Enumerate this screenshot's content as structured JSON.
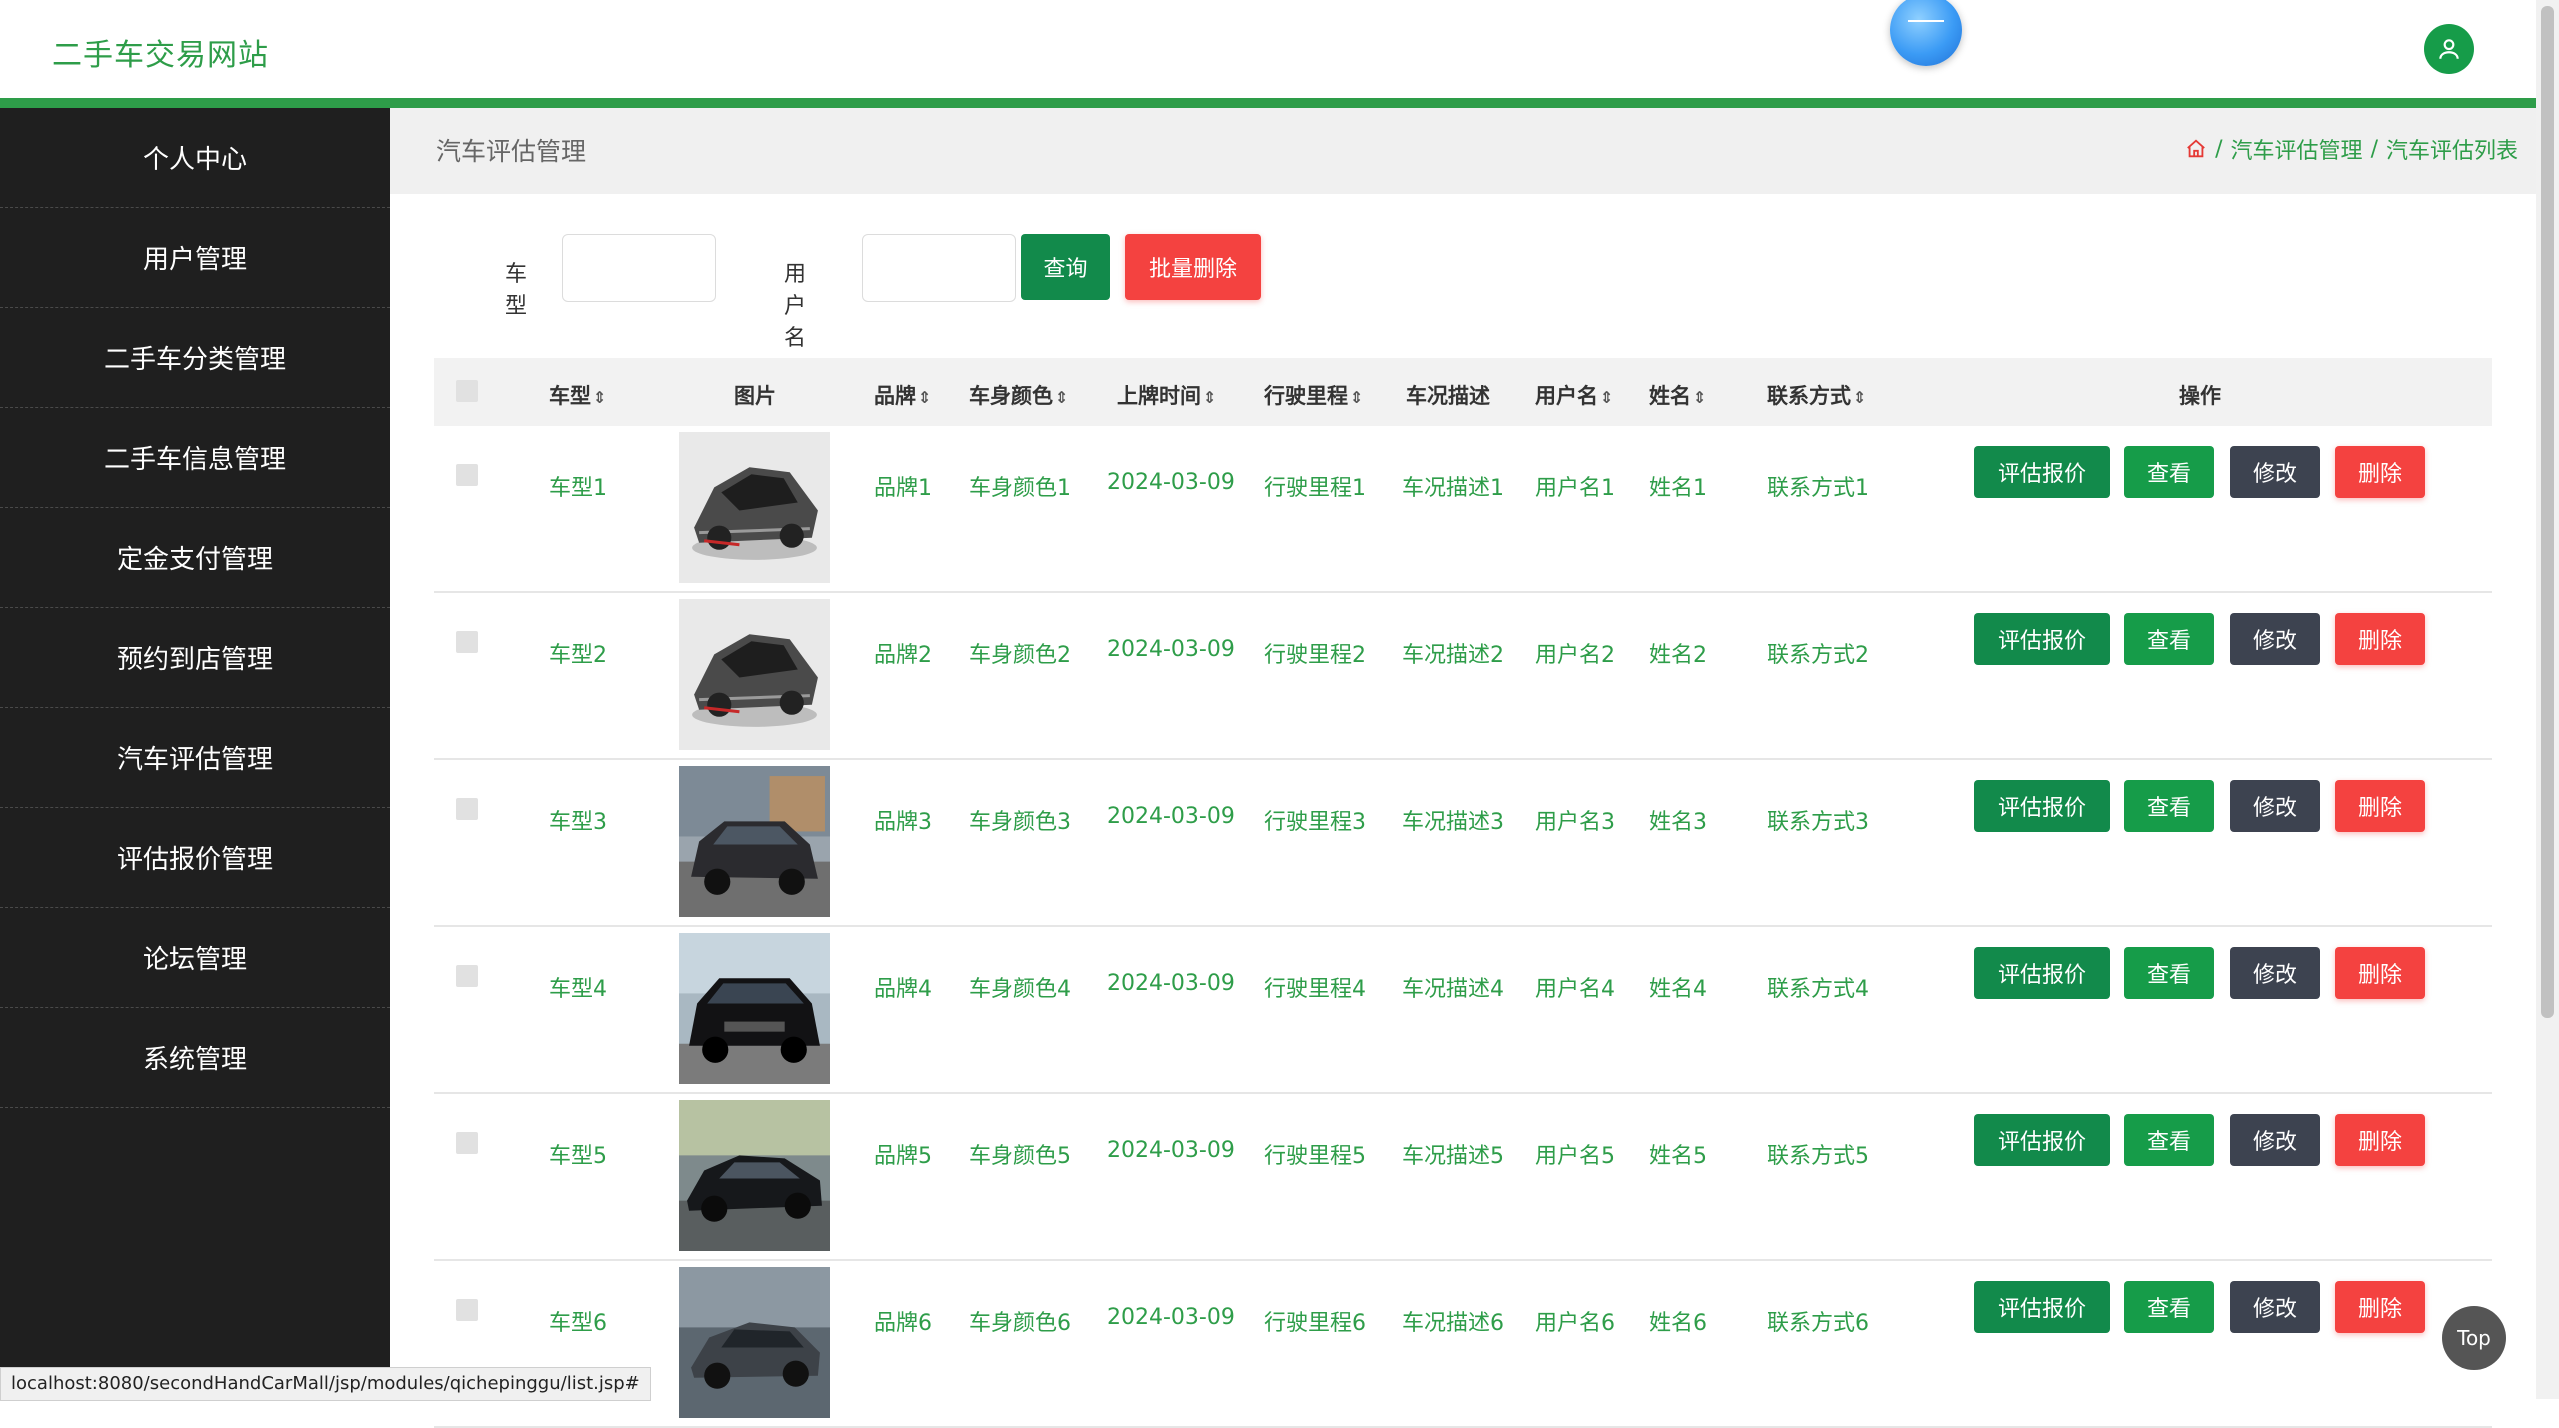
{
  "header": {
    "site_title": "二手车交易网站"
  },
  "sidebar": {
    "items": [
      {
        "label": "个人中心"
      },
      {
        "label": "用户管理"
      },
      {
        "label": "二手车分类管理"
      },
      {
        "label": "二手车信息管理"
      },
      {
        "label": "定金支付管理"
      },
      {
        "label": "预约到店管理"
      },
      {
        "label": "汽车评估管理"
      },
      {
        "label": "评估报价管理"
      },
      {
        "label": "论坛管理"
      },
      {
        "label": "系统管理"
      }
    ]
  },
  "page": {
    "title": "汽车评估管理",
    "breadcrumb": [
      "汽车评估管理",
      "汽车评估列表"
    ],
    "breadcrumb_sep": "/"
  },
  "search": {
    "car_model_label": "车型",
    "car_model_value": "",
    "username_label": "用户名",
    "username_value": "",
    "query_label": "查询",
    "batch_delete_label": "批量删除"
  },
  "table": {
    "headers": {
      "model": "车型",
      "image": "图片",
      "brand": "品牌",
      "color": "车身颜色",
      "plate_date": "上牌时间",
      "mileage": "行驶里程",
      "condition": "车况描述",
      "username": "用户名",
      "name": "姓名",
      "contact": "联系方式",
      "actions": "操作"
    },
    "sort_icon": "sort-caret",
    "action_labels": {
      "appraise": "评估报价",
      "view": "查看",
      "edit": "修改",
      "delete": "删除"
    },
    "rows": [
      {
        "model": "车型1",
        "brand": "品牌1",
        "color": "车身颜色1",
        "plate_date": "2024-03-09",
        "mileage": "行驶里程1",
        "condition": "车况描述1",
        "username": "用户名1",
        "name": "姓名1",
        "contact": "联系方式1",
        "car_style": "supercar-silver"
      },
      {
        "model": "车型2",
        "brand": "品牌2",
        "color": "车身颜色2",
        "plate_date": "2024-03-09",
        "mileage": "行驶里程2",
        "condition": "车况描述2",
        "username": "用户名2",
        "name": "姓名2",
        "contact": "联系方式2",
        "car_style": "supercar-silver"
      },
      {
        "model": "车型3",
        "brand": "品牌3",
        "color": "车身颜色3",
        "plate_date": "2024-03-09",
        "mileage": "行驶里程3",
        "condition": "车况描述3",
        "username": "用户名3",
        "name": "姓名3",
        "contact": "联系方式3",
        "car_style": "suv-dark"
      },
      {
        "model": "车型4",
        "brand": "品牌4",
        "color": "车身颜色4",
        "plate_date": "2024-03-09",
        "mileage": "行驶里程4",
        "condition": "车况描述4",
        "username": "用户名4",
        "name": "姓名4",
        "contact": "联系方式4",
        "car_style": "suv-black"
      },
      {
        "model": "车型5",
        "brand": "品牌5",
        "color": "车身颜色5",
        "plate_date": "2024-03-09",
        "mileage": "行驶里程5",
        "condition": "车况描述5",
        "username": "用户名5",
        "name": "姓名5",
        "contact": "联系方式5",
        "car_style": "sedan-black"
      },
      {
        "model": "车型6",
        "brand": "品牌6",
        "color": "车身颜色6",
        "plate_date": "2024-03-09",
        "mileage": "行驶里程6",
        "condition": "车况描述6",
        "username": "用户名6",
        "name": "姓名6",
        "contact": "联系方式6",
        "car_style": "coupe-gray"
      }
    ]
  },
  "status_bar": {
    "url": "localhost:8080/secondHandCarMall/jsp/modules/qichepinggu/list.jsp#"
  },
  "back_to_top": {
    "label": "Top"
  },
  "colors": {
    "brand_green": "#2e9d49",
    "button_green": "#169c49",
    "button_teal": "#128a4b",
    "button_red": "#f44240",
    "button_gray": "#3d4350",
    "sidebar_bg": "#1f1f1f"
  }
}
